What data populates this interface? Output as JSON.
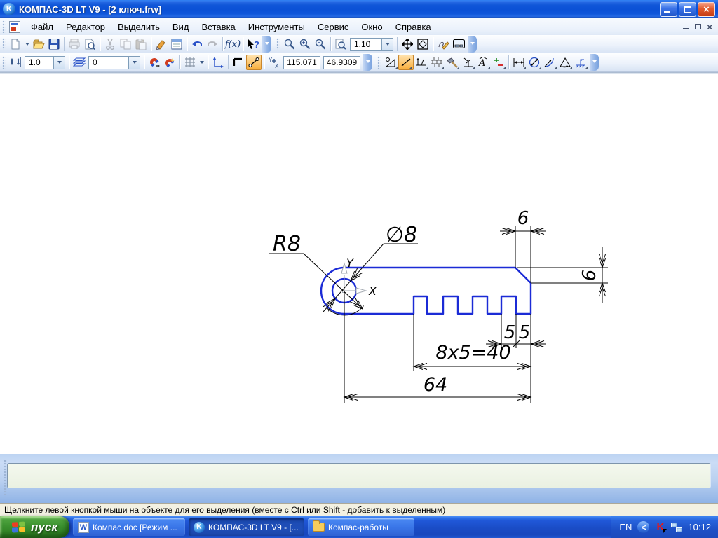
{
  "window": {
    "title": "КОМПАС-3D LT V9 - [2 ключ.frw]",
    "app_icon": "kompas-logo"
  },
  "menu": {
    "items": [
      "Файл",
      "Редактор",
      "Выделить",
      "Вид",
      "Вставка",
      "Инструменты",
      "Сервис",
      "Окно",
      "Справка"
    ]
  },
  "toolbars": {
    "standard": {
      "icons": [
        "new-document",
        "open-document",
        "save",
        "print",
        "print-preview",
        "cut",
        "copy",
        "paste",
        "copy-properties",
        "document-properties",
        "undo",
        "redo",
        "variables",
        "context-help"
      ]
    },
    "view": {
      "zoom_scale_value": "1.10",
      "icons": [
        "zoom-by-frame",
        "zoom-in",
        "zoom-out",
        "zoom-current-scale",
        "pan",
        "fit-all",
        "rebuild-view",
        "refresh-screen"
      ]
    },
    "current_state": {
      "cursor_step_value": "1.0",
      "layer_value": "0",
      "coord_x_value": "115.071",
      "coord_y_value": "46.9309",
      "icons": [
        "cursor-step",
        "layer-manager",
        "snap-settings",
        "local-snap",
        "grid",
        "local-cs",
        "ortho-drawing",
        "snap-toggle",
        "coords-indicator"
      ]
    },
    "measure_dims": {
      "icons": [
        "measure-angle",
        "auto-dimension",
        "datum-symbol",
        "collision-grid",
        "rebuild-hammer",
        "perpendicularity",
        "spell-compass",
        "tolerance-plusminus",
        "linear-dimension",
        "diameter-dimension",
        "radius-dimension",
        "angle-dimension",
        "surface-finish"
      ]
    }
  },
  "drawing": {
    "dims": {
      "radius": "R8",
      "diameter": "∅8",
      "chamfer_top": "6",
      "chamfer_side": "6",
      "tooth_left": "5",
      "tooth_right": "5",
      "pattern": "8x5=40",
      "overall": "64"
    },
    "axes": {
      "x": "X",
      "y": "Y"
    }
  },
  "status": {
    "message": "Щелкните левой кнопкой мыши на объекте для его выделения (вместе с Ctrl или Shift - добавить к выделенным)"
  },
  "taskbar": {
    "start_label": "пуск",
    "tasks": [
      {
        "label": "Компас.doc [Режим ...",
        "icon": "word-document"
      },
      {
        "label": "КОМПАС-3D LT V9 - [...",
        "icon": "kompas-logo",
        "active": true
      },
      {
        "label": "Компас-работы",
        "icon": "folder"
      }
    ],
    "tray": {
      "language": "EN",
      "time": "10:12",
      "icons": [
        "hide-icons-chevron",
        "kaspersky",
        "network"
      ]
    }
  },
  "glyphs": {
    "fx": "f(x)",
    "help_q": "?",
    "close_x": "×",
    "word_w": "W",
    "kompas_k": "K",
    "kaspersky_k": "K",
    "chevron_left": "<"
  }
}
